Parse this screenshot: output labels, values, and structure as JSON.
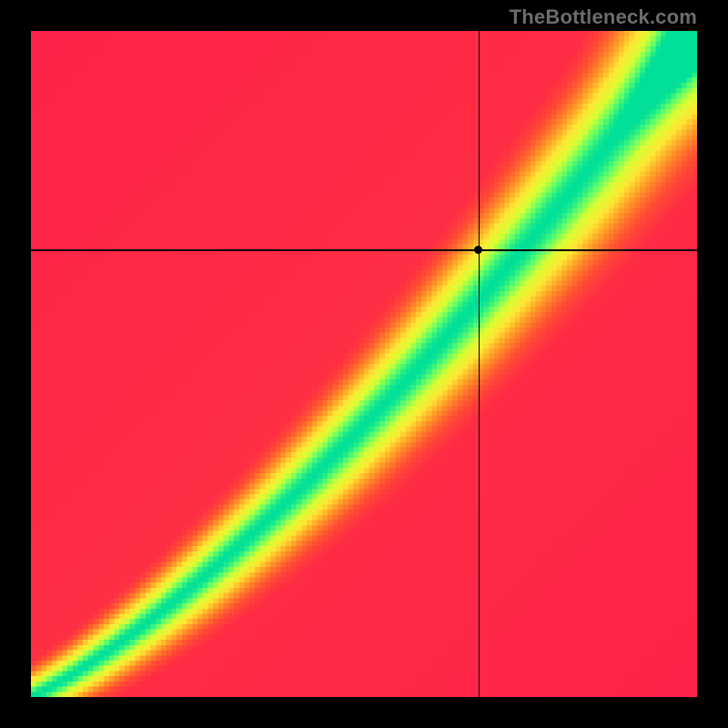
{
  "watermark": "TheBottleneck.com",
  "chart_data": {
    "type": "heatmap",
    "title": "",
    "xlabel": "",
    "ylabel": "",
    "xlim": [
      0,
      1
    ],
    "ylim": [
      0,
      1
    ],
    "grid": false,
    "legend": false,
    "crosshair": {
      "x": 0.672,
      "y": 0.672
    },
    "point": {
      "x": 0.672,
      "y": 0.672
    },
    "resolution": 128,
    "colorscale": [
      {
        "t": 0.0,
        "hex": "#ff1a4d"
      },
      {
        "t": 0.2,
        "hex": "#ff4d33"
      },
      {
        "t": 0.4,
        "hex": "#ff9926"
      },
      {
        "t": 0.6,
        "hex": "#ffe733"
      },
      {
        "t": 0.78,
        "hex": "#d7ff33"
      },
      {
        "t": 0.9,
        "hex": "#66ff66"
      },
      {
        "t": 1.0,
        "hex": "#00e099"
      }
    ],
    "note": "Heatmap depicts a diagonal optimal band (green) from bottom-left to top-right on a red–yellow–green scale; black crosshair and point mark a location inside the green band in the upper-right quadrant."
  }
}
